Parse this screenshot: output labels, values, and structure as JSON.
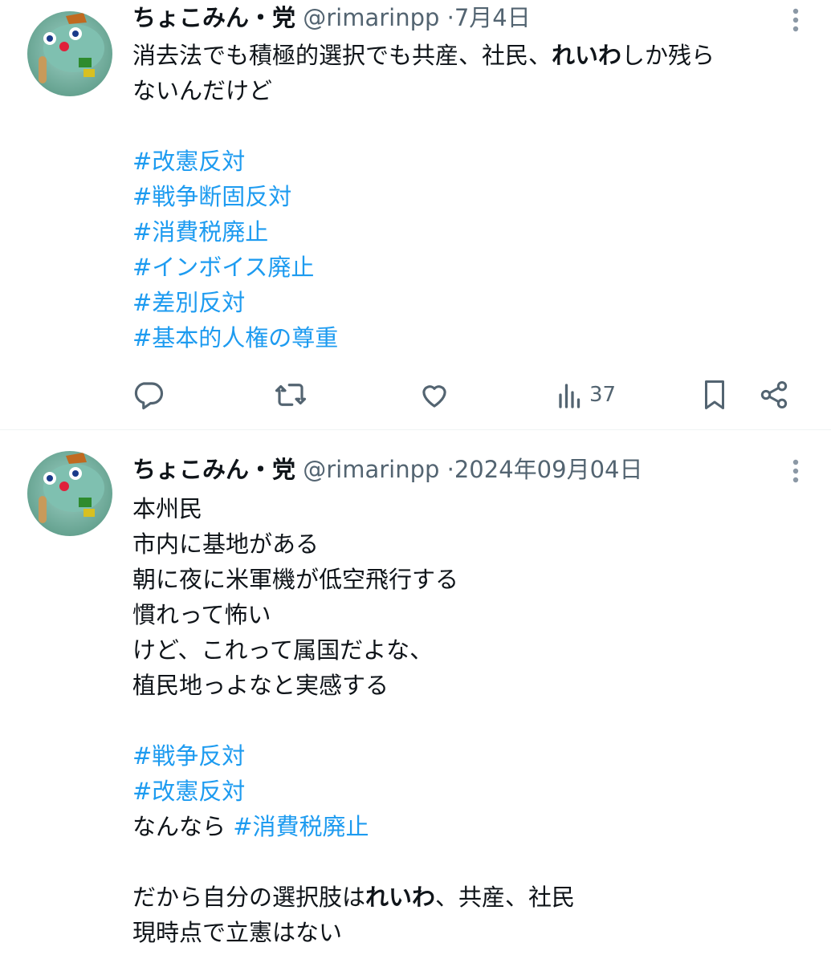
{
  "tweets": [
    {
      "display_name": "ちょこみん・党",
      "handle": "@rimarinpp",
      "separator": "·",
      "date": "7月4日",
      "text_lines": [
        [
          {
            "t": "消去法でも積極的選択でも共産、社民、"
          },
          {
            "t": "れいわ",
            "bold": true
          },
          {
            "t": "しか残ら"
          }
        ],
        [
          {
            "t": "ないんだけど"
          }
        ],
        [],
        [
          {
            "t": "#改憲反対",
            "tag": true
          }
        ],
        [
          {
            "t": "#戦争断固反対",
            "tag": true
          }
        ],
        [
          {
            "t": "#消費税廃止",
            "tag": true
          }
        ],
        [
          {
            "t": "#インボイス廃止",
            "tag": true
          }
        ],
        [
          {
            "t": "#差別反対",
            "tag": true
          }
        ],
        [
          {
            "t": "#基本的人権の尊重",
            "tag": true
          }
        ]
      ],
      "actions": {
        "reply_icon": "reply-icon",
        "retweet_icon": "retweet-icon",
        "like_icon": "heart-icon",
        "views_icon": "views-icon",
        "views_count": "37",
        "bookmark_icon": "bookmark-icon",
        "share_icon": "share-icon"
      }
    },
    {
      "display_name": "ちょこみん・党",
      "handle": "@rimarinpp",
      "separator": "·",
      "date": "2024年09月04日",
      "text_lines": [
        [
          {
            "t": "本州民"
          }
        ],
        [
          {
            "t": "市内に基地がある"
          }
        ],
        [
          {
            "t": "朝に夜に米軍機が低空飛行する"
          }
        ],
        [
          {
            "t": "慣れって怖い"
          }
        ],
        [
          {
            "t": "けど、これって属国だよな、"
          }
        ],
        [
          {
            "t": "植民地っよなと実感する"
          }
        ],
        [],
        [
          {
            "t": "#戦争反対",
            "tag": true
          }
        ],
        [
          {
            "t": "#改憲反対",
            "tag": true
          }
        ],
        [
          {
            "t": "なんなら "
          },
          {
            "t": "#消費税廃止",
            "tag": true
          }
        ],
        [],
        [
          {
            "t": "だから自分の選択肢は"
          },
          {
            "t": "れいわ",
            "bold": true
          },
          {
            "t": "、共産、社民"
          }
        ],
        [
          {
            "t": "現時点で立憲はない"
          }
        ]
      ]
    }
  ],
  "colors": {
    "link": "#1d9bf0",
    "secondary": "#536471",
    "text": "#0f1419"
  }
}
